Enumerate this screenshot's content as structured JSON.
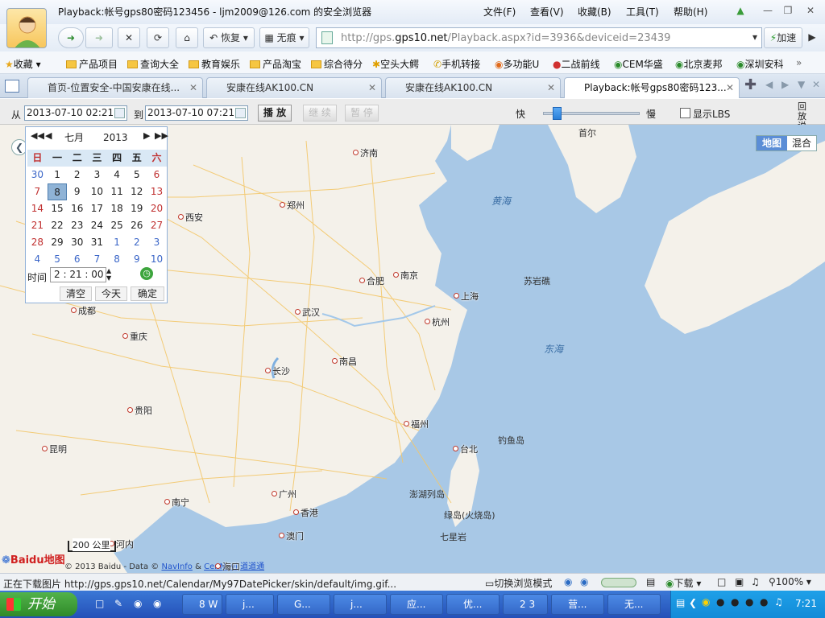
{
  "window": {
    "title": "Playback:帐号gps80密码123456 - ljm2009@126.com 的安全浏览器",
    "menu": [
      "文件(F)",
      "查看(V)",
      "收藏(B)",
      "工具(T)",
      "帮助(H)"
    ]
  },
  "nav": {
    "restore_label": "恢复",
    "noTrace_label": "无痕",
    "url_host_prefix": "http://gps.",
    "url_host_main": "gps10.net",
    "url_path": "/Playback.aspx?id=3936&deviceid=23439",
    "speedup_label": "加速"
  },
  "bookmarks": [
    "收藏",
    "产品项目",
    "查询大全",
    "教育娱乐",
    "产品淘宝",
    "综合待分",
    "空头大鳄",
    "手机转接",
    "多功能U",
    "二战前线",
    "CEM华盛",
    "北京麦邦",
    "深圳安科"
  ],
  "tabs": [
    "首页-位置安全-中国安康在线...",
    "安康在线AK100.CN",
    "安康在线AK100.CN",
    "Playback:帐号gps80密码123..."
  ],
  "toolbar": {
    "from_label": "从",
    "from_value": "2013-07-10 02:21",
    "to_label": "到",
    "to_value": "2013-07-10 07:21",
    "play_label": "播 放",
    "continue_label": "继 续",
    "pause_label": "暂 停",
    "fast_label": "快",
    "slow_label": "慢",
    "speed_level": 0.1,
    "lbs_label": "显示LBS",
    "help_label": "回放说明"
  },
  "datepicker": {
    "month": "七月",
    "year": "2013",
    "weekdays": [
      "日",
      "一",
      "二",
      "三",
      "四",
      "五",
      "六"
    ],
    "weeks": [
      [
        "30",
        "1",
        "2",
        "3",
        "4",
        "5",
        "6"
      ],
      [
        "7",
        "8",
        "9",
        "10",
        "11",
        "12",
        "13"
      ],
      [
        "14",
        "15",
        "16",
        "17",
        "18",
        "19",
        "20"
      ],
      [
        "21",
        "22",
        "23",
        "24",
        "25",
        "26",
        "27"
      ],
      [
        "28",
        "29",
        "30",
        "31",
        "1",
        "2",
        "3"
      ],
      [
        "4",
        "5",
        "6",
        "7",
        "8",
        "9",
        "10"
      ]
    ],
    "selected_day": "8",
    "time_label": "时间",
    "time_h": "2",
    "time_m": "21",
    "time_s": "00",
    "clear_label": "清空",
    "today_label": "今天",
    "ok_label": "确定"
  },
  "map": {
    "type_map": "地图",
    "type_hybrid": "混合",
    "cities": [
      "济南",
      "郑州",
      "西安",
      "合肥",
      "南京",
      "上海",
      "武汉",
      "杭州",
      "成都",
      "重庆",
      "长沙",
      "南昌",
      "贵阳",
      "福州",
      "昆明",
      "台北",
      "广州",
      "香港",
      "南宁",
      "澳门",
      "河内"
    ],
    "seas": [
      "黄海",
      "东海",
      "苏岩礁",
      "钓鱼岛",
      "澎湖列岛",
      "绿岛(火烧岛)",
      "七星岩",
      "首尔"
    ],
    "scale": "200 公里",
    "copyright": "© 2013 Baidu - Data ©",
    "copyright_link1": "NavInfo",
    "copyright_amp": "&",
    "copyright_link2": "CenNavi",
    "copyright_suffix": "道道通",
    "logo": "Baidu地图",
    "bottom_label": "海口"
  },
  "status": {
    "text": "正在下载图片 http://gps.gps10.net/Calendar/My97DatePicker/skin/default/img.gif...",
    "mode_label": "切换浏览模式",
    "download_label": "下载",
    "zoom": "100%"
  },
  "taskbar": {
    "start": "开始",
    "items": [
      "8 W",
      "j...",
      "G...",
      "j...",
      "应...",
      "优...",
      "2 3",
      "营...",
      "无..."
    ],
    "clock": "7:21"
  }
}
